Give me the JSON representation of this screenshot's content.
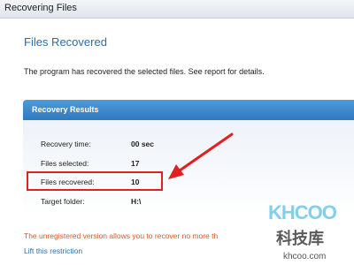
{
  "window": {
    "title": "Recovering Files"
  },
  "main": {
    "heading": "Files Recovered",
    "description": "The program has recovered the selected files. See report for details."
  },
  "results": {
    "header": "Recovery Results",
    "rows": [
      {
        "label": "Recovery time:",
        "value": "00 sec"
      },
      {
        "label": "Files selected:",
        "value": "17"
      },
      {
        "label": "Files recovered:",
        "value": "10"
      },
      {
        "label": "Target folder:",
        "value": "H:\\"
      }
    ]
  },
  "footer": {
    "warning": "The unregistered version allows you to recover no more th",
    "lift_link": "Lift this restriction"
  },
  "annotation": {
    "color": "#e32020"
  },
  "watermark": {
    "brand": "KHCOO",
    "chinese": "科技库",
    "domain": "khcoo.com"
  }
}
